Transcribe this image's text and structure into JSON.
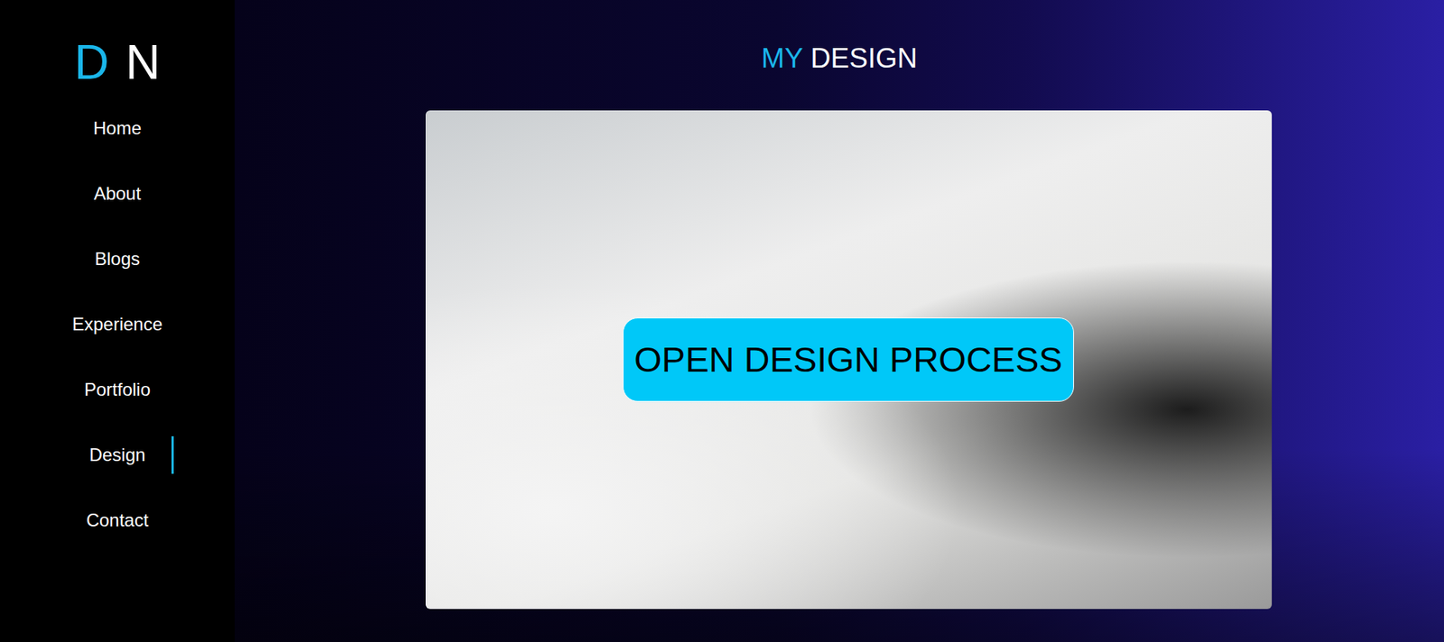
{
  "logo": [
    {
      "text": "D",
      "color": "#1ab6ea"
    },
    {
      "text": "N",
      "color": "#ffffff"
    }
  ],
  "sidebar": {
    "items": [
      {
        "label": "Home",
        "selected": false
      },
      {
        "label": "About",
        "selected": false
      },
      {
        "label": "Blogs",
        "selected": false
      },
      {
        "label": "Experience",
        "selected": false
      },
      {
        "label": "Portfolio",
        "selected": false
      },
      {
        "label": "Design",
        "selected": true
      },
      {
        "label": "Contact",
        "selected": false
      }
    ]
  },
  "section": {
    "title": [
      {
        "text": "MY",
        "color": "#1ab6ea"
      },
      {
        "text": "DESIGN",
        "color": "#ffffff"
      }
    ],
    "button": "OPEN DESIGN PROCESS"
  }
}
